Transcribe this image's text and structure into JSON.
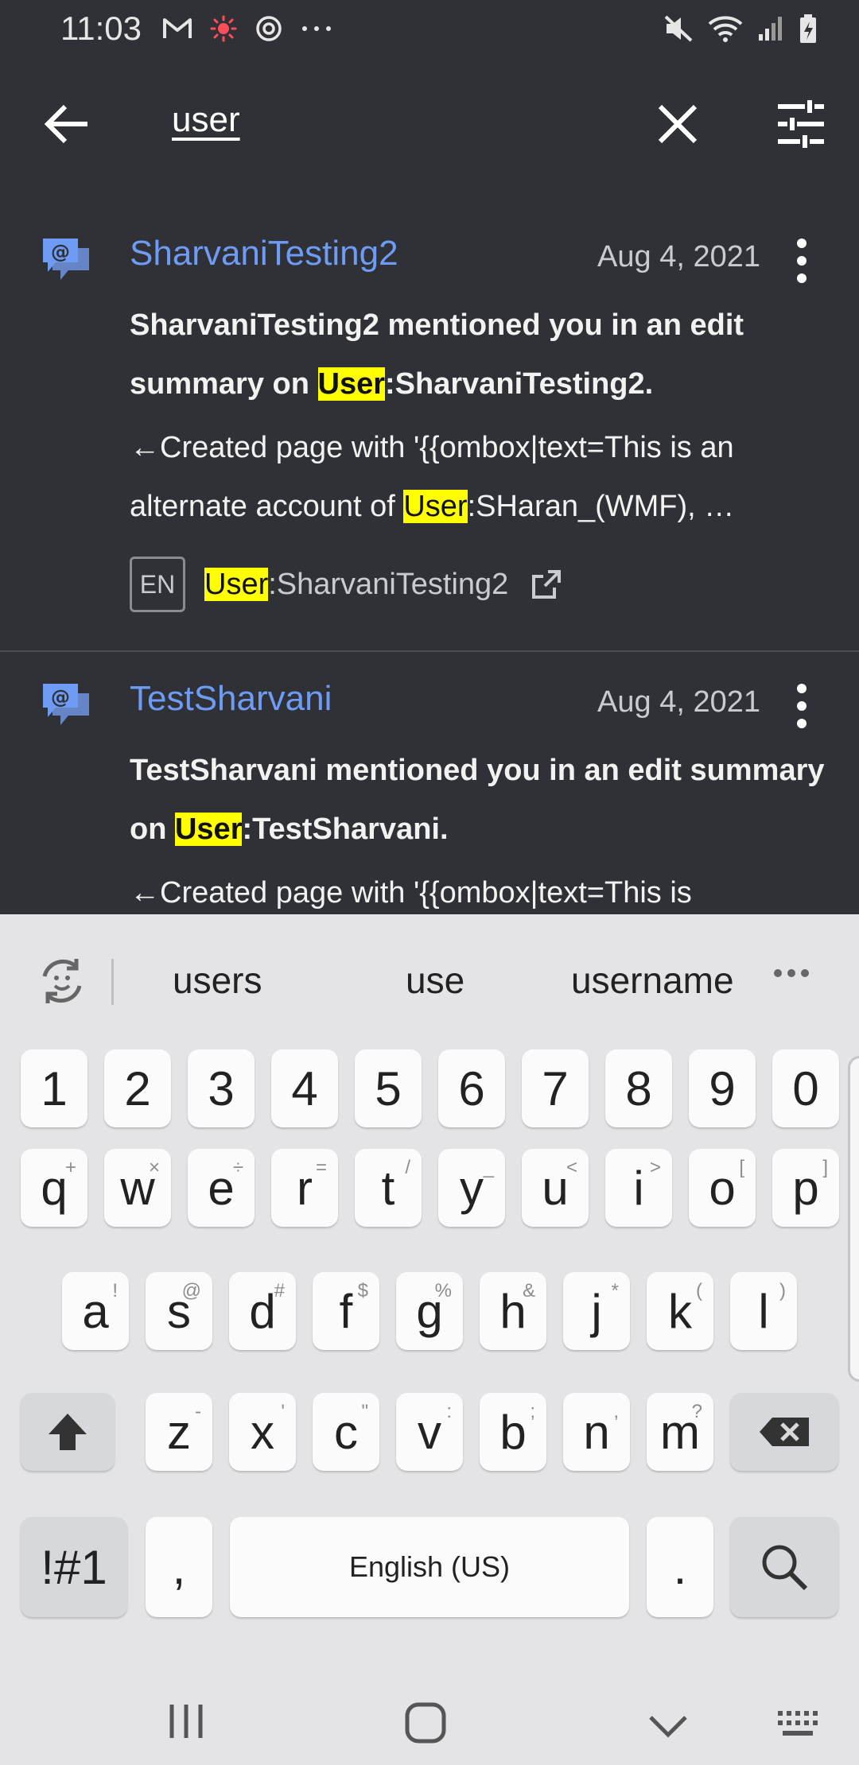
{
  "status_bar": {
    "time": "11:03",
    "left_icons": [
      "gmail-icon",
      "red-sun-icon",
      "sync-icon",
      "more-dots-icon"
    ],
    "right_icons": [
      "mute-icon",
      "wifi-icon",
      "signal-icon",
      "battery-icon"
    ]
  },
  "toolbar": {
    "search_query": "user",
    "back_icon": "arrow-left-icon",
    "clear_icon": "close-icon",
    "filter_icon": "tune-icon"
  },
  "notifications": [
    {
      "title": "SharvaniTesting2",
      "date": "Aug 4, 2021",
      "header_pre": "SharvaniTesting2 mentioned you in an edit summary on ",
      "header_hl": "User",
      "header_post": ":SharvaniTesting2.",
      "snippet_pre": "←Created page with '{{ombox|text=This is an alternate account of ",
      "snippet_hl": "User",
      "snippet_post": ":SHaran_(WMF), …",
      "lang": "EN",
      "link_hl": "User",
      "link_post": ":SharvaniTesting2"
    },
    {
      "title": "TestSharvani",
      "date": "Aug 4, 2021",
      "header_pre": "TestSharvani mentioned you in an edit summary on ",
      "header_hl": "User",
      "header_post": ":TestSharvani.",
      "snippet_pre": "←Created page with '{{ombox|text=This is"
    }
  ],
  "keyboard": {
    "suggestions": [
      "users",
      "use",
      "username"
    ],
    "number_row": [
      "1",
      "2",
      "3",
      "4",
      "5",
      "6",
      "7",
      "8",
      "9",
      "0"
    ],
    "row1": [
      {
        "key": "q",
        "sub": "+"
      },
      {
        "key": "w",
        "sub": "×"
      },
      {
        "key": "e",
        "sub": "÷"
      },
      {
        "key": "r",
        "sub": "="
      },
      {
        "key": "t",
        "sub": "/"
      },
      {
        "key": "y",
        "sub": "_"
      },
      {
        "key": "u",
        "sub": "<"
      },
      {
        "key": "i",
        "sub": ">"
      },
      {
        "key": "o",
        "sub": "["
      },
      {
        "key": "p",
        "sub": "]"
      }
    ],
    "row2": [
      {
        "key": "a",
        "sub": "!"
      },
      {
        "key": "s",
        "sub": "@"
      },
      {
        "key": "d",
        "sub": "#"
      },
      {
        "key": "f",
        "sub": "$"
      },
      {
        "key": "g",
        "sub": "%"
      },
      {
        "key": "h",
        "sub": "&"
      },
      {
        "key": "j",
        "sub": "*"
      },
      {
        "key": "k",
        "sub": "("
      },
      {
        "key": "l",
        "sub": ")"
      }
    ],
    "row3": [
      {
        "key": "z",
        "sub": "-"
      },
      {
        "key": "x",
        "sub": "'"
      },
      {
        "key": "c",
        "sub": "\""
      },
      {
        "key": "v",
        "sub": ":"
      },
      {
        "key": "b",
        "sub": ";"
      },
      {
        "key": "n",
        "sub": ","
      },
      {
        "key": "m",
        "sub": "?"
      }
    ],
    "symbols_label": "!#1",
    "comma_label": ",",
    "space_label": "English (US)",
    "period_label": ".",
    "shift_icon": "shift-icon",
    "backspace_icon": "backspace-icon",
    "search_icon": "search-icon"
  },
  "nav_bar": {
    "buttons": [
      "recents-icon",
      "home-icon",
      "hide-keyboard-icon",
      "keyboard-icon"
    ]
  }
}
